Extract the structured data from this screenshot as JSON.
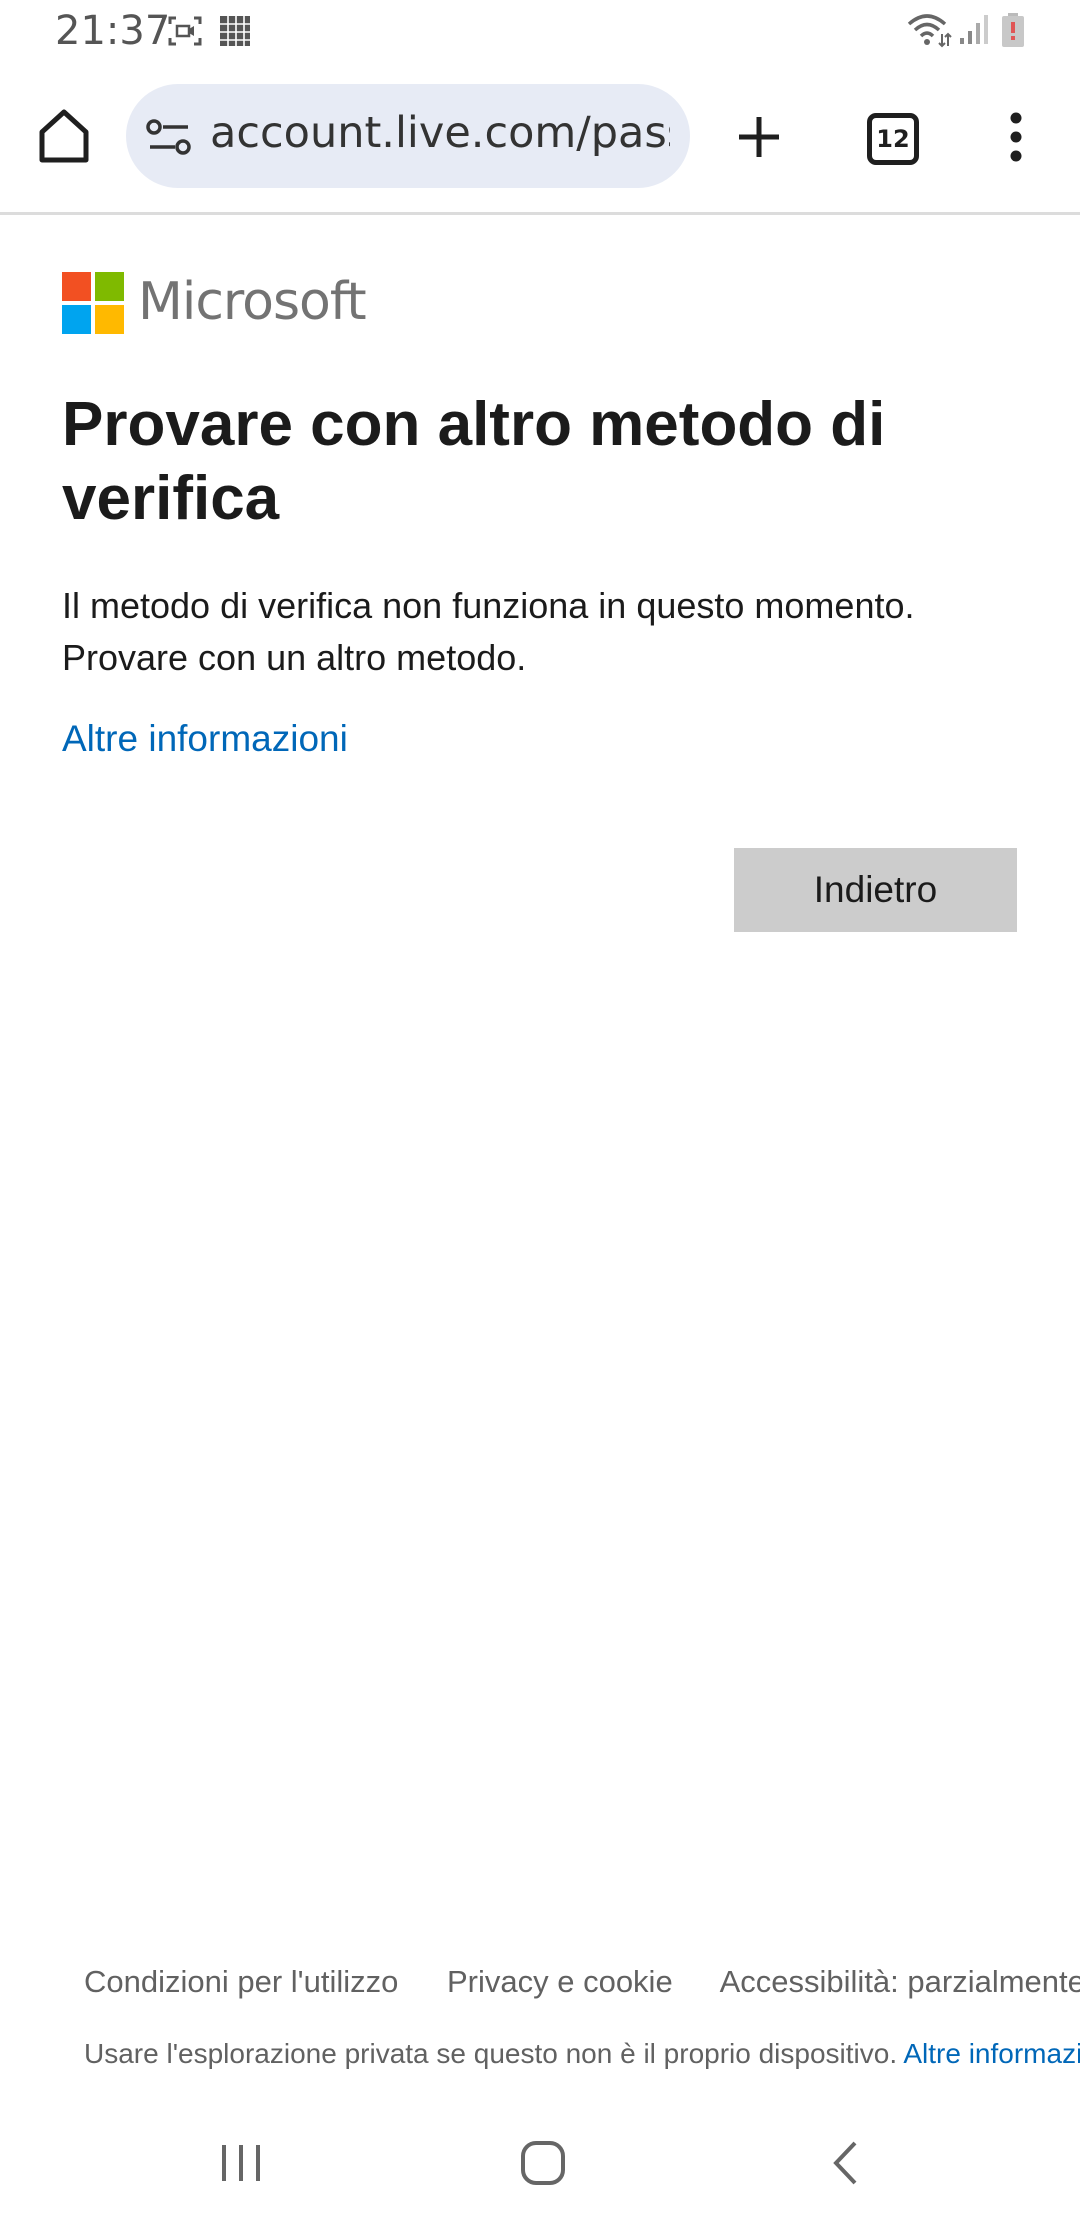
{
  "status_bar": {
    "time": "21:37"
  },
  "browser": {
    "url": "account.live.com/password",
    "tab_count": "12"
  },
  "page": {
    "brand_name": "Microsoft",
    "brand_colors": {
      "red": "#f25022",
      "green": "#7fba00",
      "blue": "#00a4ef",
      "yellow": "#ffb900"
    },
    "heading": "Provare con altro metodo di verifica",
    "description": "Il metodo di verifica non funziona in questo momento. Provare con un altro metodo.",
    "more_info_link": "Altre informazioni",
    "back_button": "Indietro"
  },
  "footer": {
    "links": [
      "Condizioni per l'utilizzo",
      "Privacy e cookie",
      "Accessibilità: parzialmente conforme"
    ],
    "private_note": "Usare l'esplorazione privata se questo non è il proprio dispositivo.",
    "private_note_link": "Altre informazioni"
  },
  "colors": {
    "link": "#0067b8",
    "button_bg": "#cccccc",
    "url_pill_bg": "#e7ebf5"
  }
}
